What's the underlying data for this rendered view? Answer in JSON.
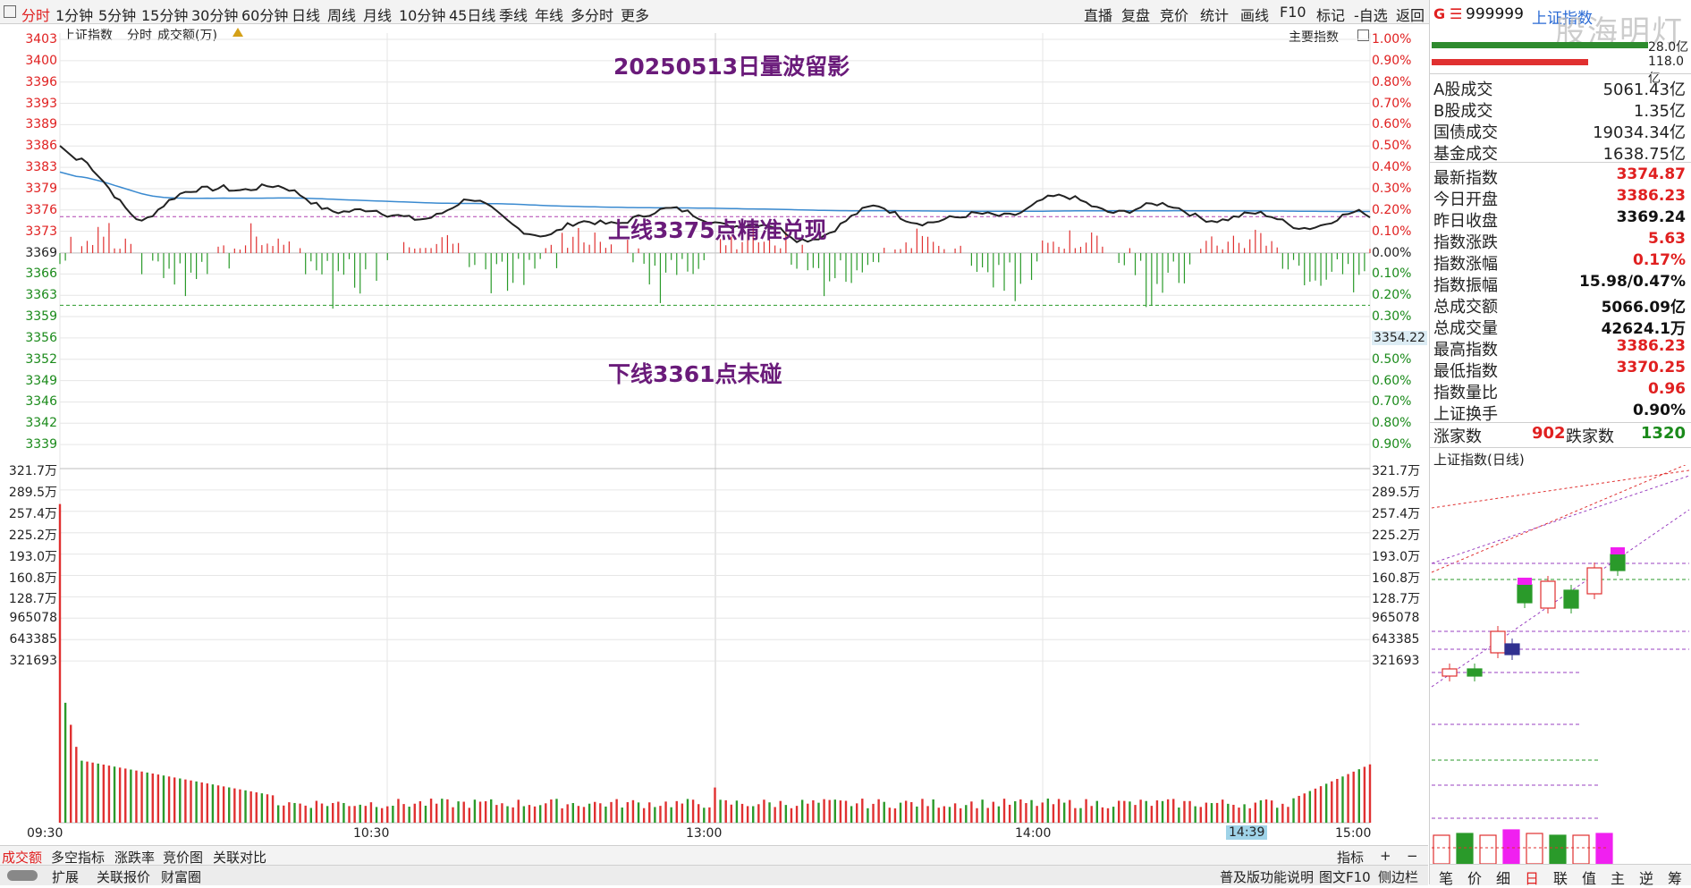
{
  "toolbar": {
    "icon": "panel-toggle-icon",
    "left_items": [
      "分时",
      "1分钟",
      "5分钟",
      "15分钟",
      "30分钟",
      "60分钟",
      "日线",
      "周线",
      "月线",
      "10分钟",
      "45日线",
      "季线",
      "年线",
      "多分时",
      "更多"
    ],
    "active": "分时",
    "right_items": [
      "直播",
      "复盘",
      "竞价",
      "统计",
      "画线",
      "F10",
      "标记",
      "-自选",
      "返回"
    ]
  },
  "chart_header": {
    "index_name": "上证指数",
    "mode": "分时",
    "volume_label": "成交额(万)",
    "right_label": "主要指数"
  },
  "annotations": {
    "title": "20250513日量波留影",
    "upper": "上线3375点精准兑现",
    "lower": "下线3361点未碰"
  },
  "price_axis": {
    "left": [
      "3403",
      "3400",
      "3396",
      "3393",
      "3389",
      "3386",
      "3383",
      "3379",
      "3376",
      "3373",
      "3369",
      "3366",
      "3363",
      "3359",
      "3356",
      "3352",
      "3349",
      "3346",
      "3342",
      "3339"
    ],
    "right": [
      "1.00%",
      "0.90%",
      "0.80%",
      "0.70%",
      "0.60%",
      "0.50%",
      "0.40%",
      "0.30%",
      "0.20%",
      "0.10%",
      "0.00%",
      "0.10%",
      "0.20%",
      "0.30%",
      "",
      "0.50%",
      "0.60%",
      "0.70%",
      "0.80%",
      "0.90%"
    ],
    "marker": "3354.22"
  },
  "volume_axis": {
    "left": [
      "321.7万",
      "289.5万",
      "257.4万",
      "225.2万",
      "193.0万",
      "160.8万",
      "128.7万",
      "965078",
      "643385",
      "321693"
    ],
    "right": [
      "321.7万",
      "289.5万",
      "257.4万",
      "225.2万",
      "193.0万",
      "160.8万",
      "128.7万",
      "965078",
      "643385",
      "321693"
    ]
  },
  "time_axis": [
    "09:30",
    "10:30",
    "13:00",
    "14:00",
    "15:00"
  ],
  "cursor_time": "14:39",
  "chart_data": {
    "type": "line",
    "x": [
      "09:30",
      "09:45",
      "10:00",
      "10:15",
      "10:30",
      "10:45",
      "11:00",
      "11:15",
      "11:30/13:00",
      "13:15",
      "13:30",
      "13:45",
      "14:00",
      "14:15",
      "14:30",
      "14:45",
      "15:00"
    ],
    "series": [
      {
        "name": "上证指数",
        "values": [
          3386.2,
          3375.0,
          3380.5,
          3378.0,
          3374.5,
          3377.0,
          3372.0,
          3375.5,
          3375.0,
          3371.5,
          3376.0,
          3374.0,
          3377.5,
          3376.5,
          3375.5,
          3374.0,
          3374.87
        ]
      }
    ],
    "ylim": [
      3337,
      3405
    ],
    "reference": {
      "prev_close": 3369.24,
      "upper_line": 3375,
      "lower_line": 3361
    }
  },
  "bottom_tabs": [
    "成交额",
    "多空指标",
    "涨跌率",
    "竞价图",
    "关联对比"
  ],
  "bottom_right": [
    "指标",
    "+",
    "−"
  ],
  "status_bar": {
    "left": [
      "扩展",
      "关联报价",
      "财富圈"
    ],
    "right": [
      "普及版功能说明",
      "图文F10",
      "侧边栏"
    ]
  },
  "panel": {
    "code": "999999",
    "name": "上证指数",
    "watermark": "股海明灯",
    "bar_labels": [
      "28.0亿",
      "118.0亿"
    ],
    "turnover": [
      {
        "k": "A股成交",
        "v": "5061.43亿"
      },
      {
        "k": "B股成交",
        "v": "1.35亿"
      },
      {
        "k": "国债成交",
        "v": "19034.34亿"
      },
      {
        "k": "基金成交",
        "v": "1638.75亿"
      }
    ],
    "stats": [
      {
        "k": "最新指数",
        "v": "3374.87",
        "red": true
      },
      {
        "k": "今日开盘",
        "v": "3386.23",
        "red": true
      },
      {
        "k": "昨日收盘",
        "v": "3369.24",
        "red": false
      },
      {
        "k": "指数涨跌",
        "v": "5.63",
        "red": true
      },
      {
        "k": "指数涨幅",
        "v": "0.17%",
        "red": true
      },
      {
        "k": "指数振幅",
        "v": "15.98/0.47%",
        "red": false
      },
      {
        "k": "总成交额",
        "v": "5066.09亿",
        "red": false
      },
      {
        "k": "总成交量",
        "v": "42624.1万",
        "red": false
      },
      {
        "k": "最高指数",
        "v": "3386.23",
        "red": true
      },
      {
        "k": "最低指数",
        "v": "3370.25",
        "red": true
      },
      {
        "k": "指数量比",
        "v": "0.96",
        "red": true
      },
      {
        "k": "上证换手",
        "v": "0.90%",
        "red": false
      }
    ],
    "breadth": {
      "up_label": "涨家数",
      "up": "902",
      "down_label": "跌家数",
      "down": "1320"
    },
    "daily_title": "上证指数(日线)",
    "bottom_buttons": [
      "笔",
      "价",
      "细",
      "日",
      "联",
      "值",
      "主",
      "逆",
      "筹"
    ]
  }
}
